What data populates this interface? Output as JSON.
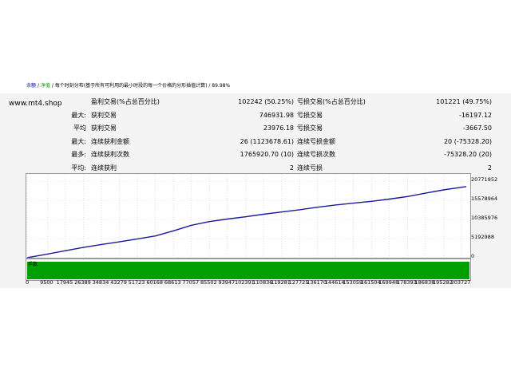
{
  "site_label": "www.mt4.shop",
  "stats_rows": [
    {
      "c1": "",
      "c2": "盈利交易(%占总百分比)",
      "c3": "102242 (50.25%)",
      "c4": "亏损交易(%占总百分比)",
      "c5": "101221 (49.75%)"
    },
    {
      "c1": "最大:",
      "c2": "获利交易",
      "c3": "746931.98",
      "c4": "亏损交易",
      "c5": "-16197.12"
    },
    {
      "c1": "平均",
      "c2": "获利交易",
      "c3": "23976.18",
      "c4": "亏损交易",
      "c5": "-3667.50"
    },
    {
      "c1": "最大:",
      "c2": "连续获利金额",
      "c3": "26 (1123678.61)",
      "c4": "连续亏损金额",
      "c5": "20 (-75328.20)"
    },
    {
      "c1": "最多:",
      "c2": "连续获利次数",
      "c3": "1765920.70 (10)",
      "c4": "连续亏损次数",
      "c5": "-75328.20 (20)"
    },
    {
      "c1": "平均:",
      "c2": "连续获利",
      "c3": "2",
      "c4": "连续亏损",
      "c5": "2"
    }
  ],
  "legend": {
    "balance": "余额",
    "equity": "净值",
    "description": "每个时刻分布(基于所有可利用的最小时段的每一个价格的分形插值计算)",
    "quality": "89.98%"
  },
  "volume_label": "手数",
  "colors": {
    "curve": "#1a1a9a",
    "volume": "#00a000",
    "grid": "#c8c8c8"
  },
  "chart_data": {
    "type": "line",
    "title": "",
    "xlabel": "",
    "ylabel": "",
    "y_tick_labels": [
      "20771952",
      "15578964",
      "10385976",
      "5192988",
      "0"
    ],
    "x_tick_labels": [
      "0",
      "9500",
      "17945",
      "26389",
      "34834",
      "43279",
      "51723",
      "60168",
      "68613",
      "77057",
      "85502",
      "93947",
      "102391",
      "110836",
      "119281",
      "127725",
      "136170",
      "144614",
      "153059",
      "161504",
      "169948",
      "178393",
      "186838",
      "195282",
      "203727"
    ],
    "ylim": [
      0,
      20771952
    ],
    "xlim": [
      0,
      203727
    ],
    "series": [
      {
        "values": [
          [
            0,
            0
          ],
          [
            9500,
            1000000
          ],
          [
            17945,
            1900000
          ],
          [
            26389,
            2800000
          ],
          [
            34834,
            3600000
          ],
          [
            43279,
            4300000
          ],
          [
            51723,
            5100000
          ],
          [
            60168,
            5900000
          ],
          [
            68613,
            7300000
          ],
          [
            77057,
            8800000
          ],
          [
            85502,
            9800000
          ],
          [
            93947,
            10500000
          ],
          [
            102391,
            11100000
          ],
          [
            110836,
            11800000
          ],
          [
            119281,
            12400000
          ],
          [
            127725,
            13000000
          ],
          [
            136170,
            13700000
          ],
          [
            144614,
            14300000
          ],
          [
            153059,
            14800000
          ],
          [
            161504,
            15300000
          ],
          [
            169948,
            15900000
          ],
          [
            178393,
            16600000
          ],
          [
            186838,
            17500000
          ],
          [
            195282,
            18400000
          ],
          [
            203727,
            19100000
          ],
          [
            206000,
            19300000
          ]
        ]
      }
    ]
  }
}
